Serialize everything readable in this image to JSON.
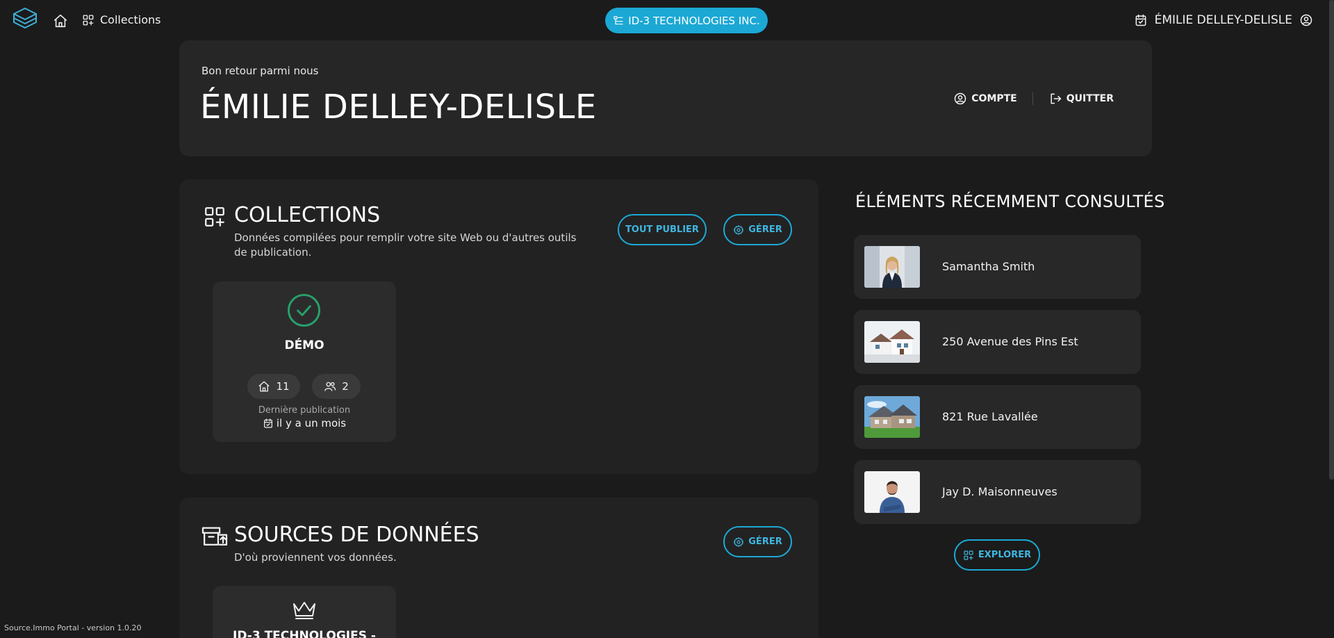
{
  "topbar": {
    "collections_label": "Collections",
    "org_label": "ID-3 TECHNOLOGIES INC.",
    "user_name": "ÉMILIE DELLEY-DELISLE"
  },
  "welcome": {
    "greeting": "Bon retour parmi nous",
    "name": "ÉMILIE DELLEY-DELISLE",
    "account_label": "COMPTE",
    "quit_label": "QUITTER"
  },
  "collections": {
    "title": "COLLECTIONS",
    "description": "Données compilées pour remplir votre site Web ou d'autres outils de publication.",
    "publish_all_label": "TOUT PUBLIER",
    "manage_label": "GÉRER",
    "card": {
      "title": "DÉMO",
      "listings_count": "11",
      "users_count": "2",
      "last_pub_label": "Dernière publication",
      "last_pub_value": "il y a un mois"
    }
  },
  "sources": {
    "title": "SOURCES DE DONNÉES",
    "description": "D'où proviennent vos données.",
    "manage_label": "GÉRER",
    "card_title": "ID-3 TECHNOLOGIES -"
  },
  "recent": {
    "title": "ÉLÉMENTS RÉCEMMENT CONSULTÉS",
    "items": [
      {
        "label": "Samantha Smith"
      },
      {
        "label": "250 Avenue des Pins Est"
      },
      {
        "label": "821 Rue Lavallée"
      },
      {
        "label": "Jay D. Maisonneuves"
      }
    ],
    "explore_label": "EXPLORER"
  },
  "footer": {
    "version": "Source.Immo Portal - version 1.0.20"
  },
  "colors": {
    "accent": "#1ba8d4",
    "success": "#27a06b",
    "background": "#1b1b1b"
  }
}
